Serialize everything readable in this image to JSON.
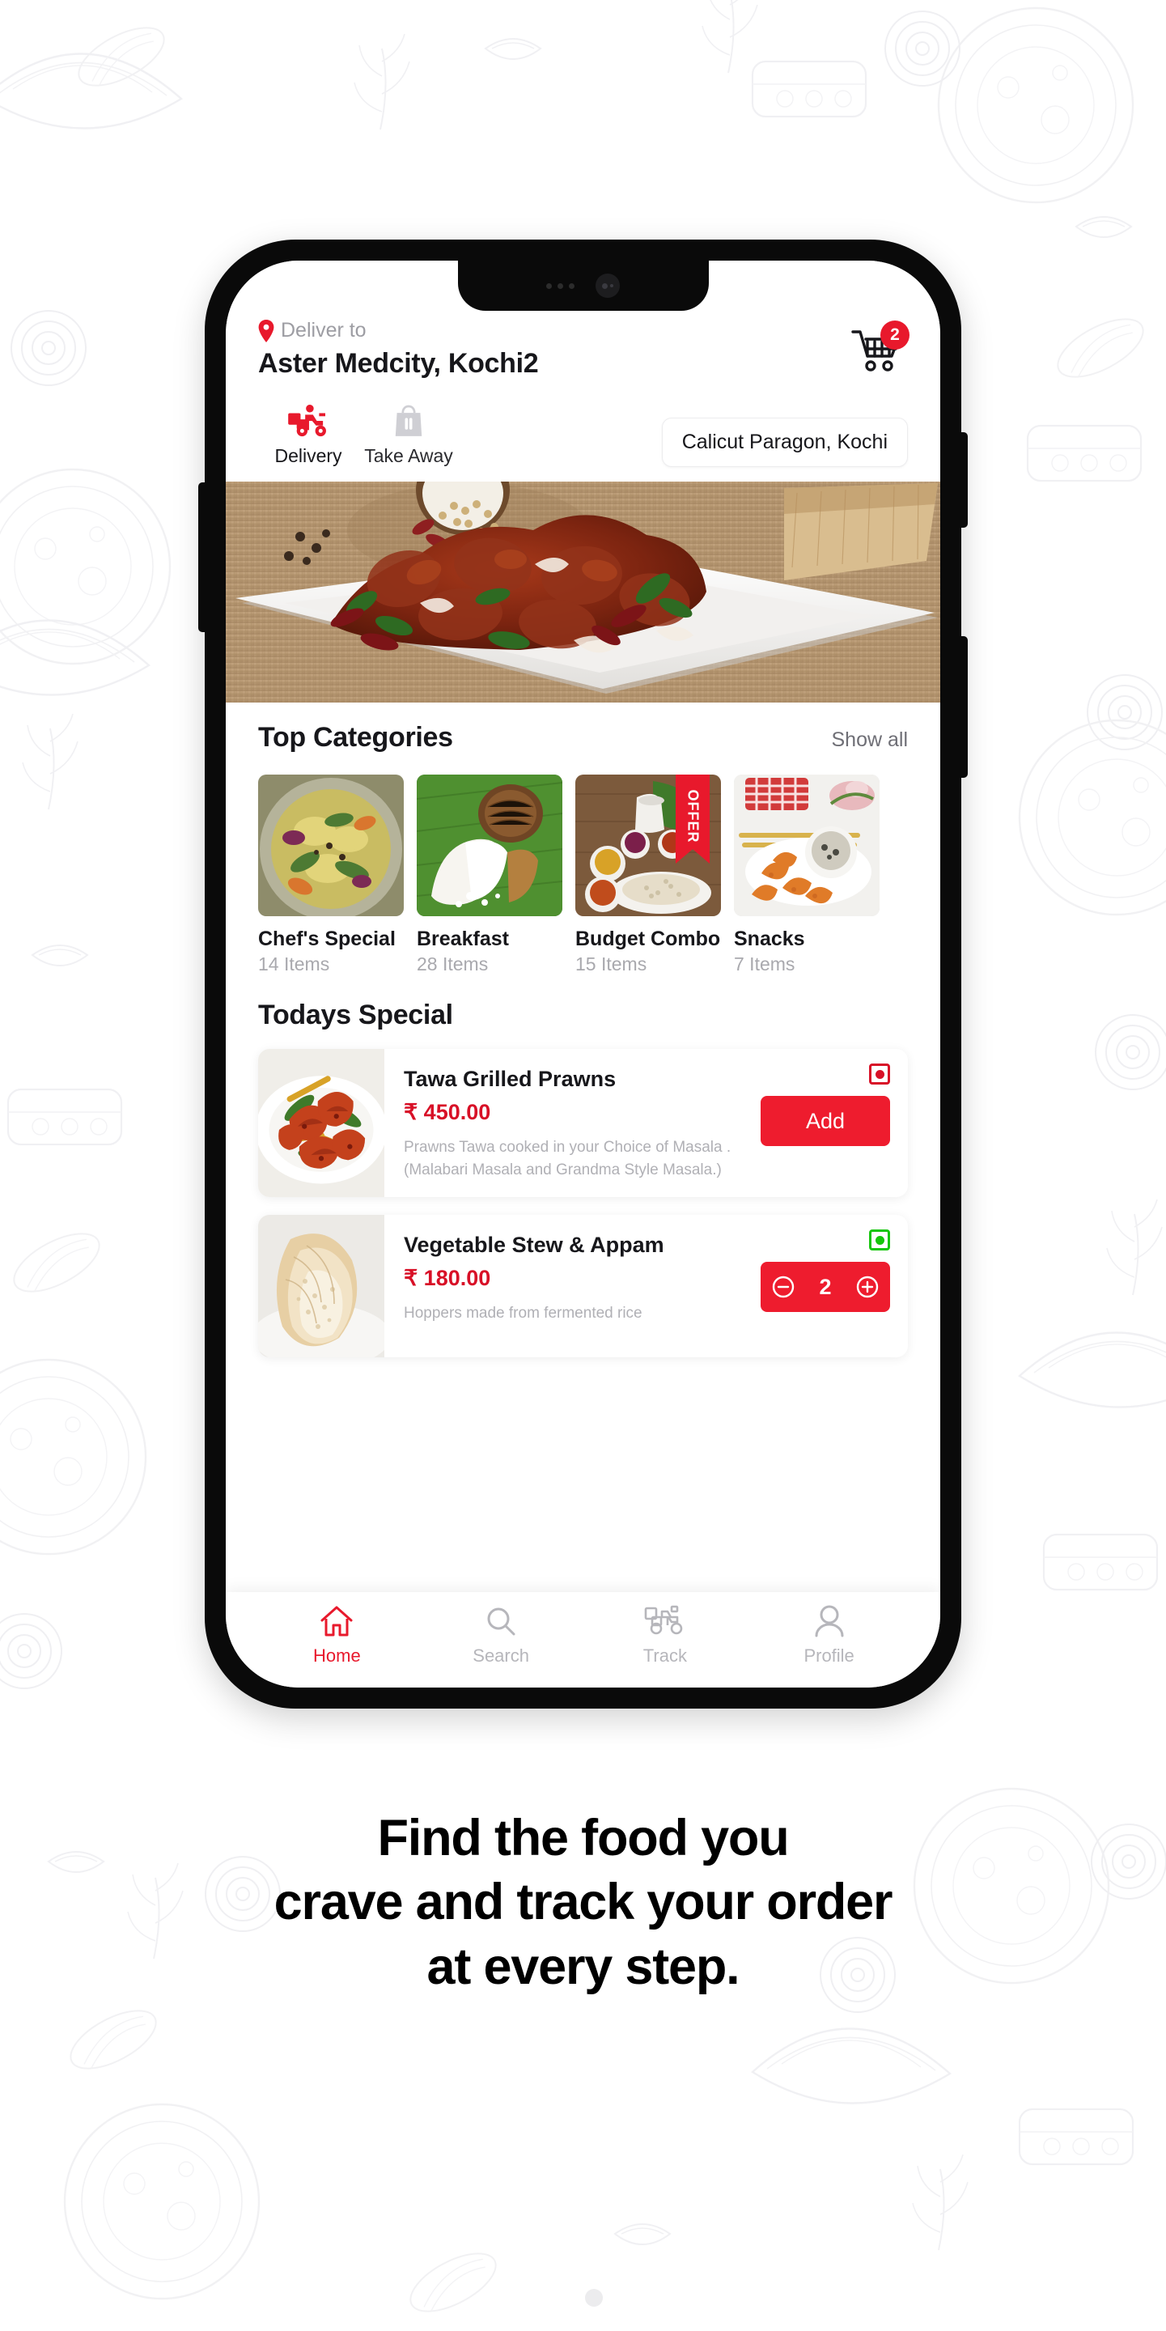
{
  "background": {
    "art": "food-line-art-pattern",
    "color": "#ffffff"
  },
  "colors": {
    "brand_red": "#e8192c",
    "button_red": "#ee1c2e",
    "price_red": "#d81027",
    "veg_green": "#16c60c",
    "text_dark": "#17171b",
    "text_muted": "#a9a9ae"
  },
  "phone": {
    "notch": {
      "speaker": "speaker-slit",
      "camera": "front-camera"
    },
    "buttons": [
      "volume-rocker-left",
      "button-right-upper",
      "power-button-right"
    ]
  },
  "app": {
    "header": {
      "deliver_to_label": "Deliver to",
      "address": "Aster Medcity, Kochi2",
      "location_icon": "location-pin-icon",
      "cart_icon": "shopping-cart-icon",
      "cart_count": "2"
    },
    "modes": [
      {
        "label": "Delivery",
        "icon": "scooter-delivery-icon",
        "active": true
      },
      {
        "label": "Take Away",
        "icon": "takeaway-bag-icon",
        "active": false
      }
    ],
    "restaurant": "Calicut Paragon, Kochi",
    "hero": {
      "alt": "chicken-roast-on-white-plate"
    },
    "categories_section": {
      "title": "Top Categories",
      "show_all": "Show all",
      "items": [
        {
          "name": "Chef's Special",
          "count": "14 Items",
          "image": "kerala-curry-bowl",
          "offer": ""
        },
        {
          "name": "Breakfast",
          "count": "28 Items",
          "image": "puttu-and-coconut",
          "offer": ""
        },
        {
          "name": "Budget Combo",
          "count": "15 Items",
          "image": "rice-meal-combo",
          "offer": "OFFER"
        },
        {
          "name": "Snacks",
          "count": "7 Items",
          "image": "fried-snacks",
          "offer": ""
        }
      ]
    },
    "specials_section": {
      "title": "Todays Special",
      "items": [
        {
          "name": "Tawa Grilled Prawns",
          "price": "₹ 450.00",
          "description": "Prawns Tawa cooked in your Choice of Masala . (Malabari Masala and Grandma Style Masala.)",
          "diet": "non-veg",
          "image": "grilled-prawns-plate",
          "action": "add",
          "add_label": "Add",
          "quantity": ""
        },
        {
          "name": "Vegetable Stew & Appam",
          "price": "₹ 180.00",
          "description": "Hoppers made from fermented rice",
          "diet": "veg",
          "image": "appam-hopper",
          "action": "stepper",
          "add_label": "",
          "quantity": "2"
        }
      ]
    },
    "bottom_nav": [
      {
        "label": "Home",
        "icon": "home-icon",
        "active": true
      },
      {
        "label": "Search",
        "icon": "search-icon",
        "active": false
      },
      {
        "label": "Track",
        "icon": "scooter-track-icon",
        "active": false
      },
      {
        "label": "Profile",
        "icon": "person-icon",
        "active": false
      }
    ]
  },
  "tagline": {
    "line1": "Find the food you",
    "line2": "crave and track your order",
    "line3": "at every step."
  }
}
